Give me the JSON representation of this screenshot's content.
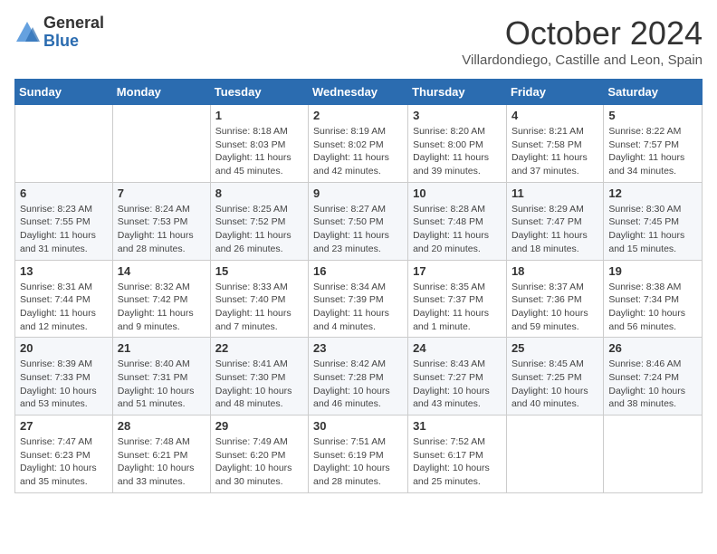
{
  "header": {
    "logo_general": "General",
    "logo_blue": "Blue",
    "month_title": "October 2024",
    "location": "Villardondiego, Castille and Leon, Spain"
  },
  "days_of_week": [
    "Sunday",
    "Monday",
    "Tuesday",
    "Wednesday",
    "Thursday",
    "Friday",
    "Saturday"
  ],
  "weeks": [
    [
      {
        "day": "",
        "text": ""
      },
      {
        "day": "",
        "text": ""
      },
      {
        "day": "1",
        "text": "Sunrise: 8:18 AM\nSunset: 8:03 PM\nDaylight: 11 hours and 45 minutes."
      },
      {
        "day": "2",
        "text": "Sunrise: 8:19 AM\nSunset: 8:02 PM\nDaylight: 11 hours and 42 minutes."
      },
      {
        "day": "3",
        "text": "Sunrise: 8:20 AM\nSunset: 8:00 PM\nDaylight: 11 hours and 39 minutes."
      },
      {
        "day": "4",
        "text": "Sunrise: 8:21 AM\nSunset: 7:58 PM\nDaylight: 11 hours and 37 minutes."
      },
      {
        "day": "5",
        "text": "Sunrise: 8:22 AM\nSunset: 7:57 PM\nDaylight: 11 hours and 34 minutes."
      }
    ],
    [
      {
        "day": "6",
        "text": "Sunrise: 8:23 AM\nSunset: 7:55 PM\nDaylight: 11 hours and 31 minutes."
      },
      {
        "day": "7",
        "text": "Sunrise: 8:24 AM\nSunset: 7:53 PM\nDaylight: 11 hours and 28 minutes."
      },
      {
        "day": "8",
        "text": "Sunrise: 8:25 AM\nSunset: 7:52 PM\nDaylight: 11 hours and 26 minutes."
      },
      {
        "day": "9",
        "text": "Sunrise: 8:27 AM\nSunset: 7:50 PM\nDaylight: 11 hours and 23 minutes."
      },
      {
        "day": "10",
        "text": "Sunrise: 8:28 AM\nSunset: 7:48 PM\nDaylight: 11 hours and 20 minutes."
      },
      {
        "day": "11",
        "text": "Sunrise: 8:29 AM\nSunset: 7:47 PM\nDaylight: 11 hours and 18 minutes."
      },
      {
        "day": "12",
        "text": "Sunrise: 8:30 AM\nSunset: 7:45 PM\nDaylight: 11 hours and 15 minutes."
      }
    ],
    [
      {
        "day": "13",
        "text": "Sunrise: 8:31 AM\nSunset: 7:44 PM\nDaylight: 11 hours and 12 minutes."
      },
      {
        "day": "14",
        "text": "Sunrise: 8:32 AM\nSunset: 7:42 PM\nDaylight: 11 hours and 9 minutes."
      },
      {
        "day": "15",
        "text": "Sunrise: 8:33 AM\nSunset: 7:40 PM\nDaylight: 11 hours and 7 minutes."
      },
      {
        "day": "16",
        "text": "Sunrise: 8:34 AM\nSunset: 7:39 PM\nDaylight: 11 hours and 4 minutes."
      },
      {
        "day": "17",
        "text": "Sunrise: 8:35 AM\nSunset: 7:37 PM\nDaylight: 11 hours and 1 minute."
      },
      {
        "day": "18",
        "text": "Sunrise: 8:37 AM\nSunset: 7:36 PM\nDaylight: 10 hours and 59 minutes."
      },
      {
        "day": "19",
        "text": "Sunrise: 8:38 AM\nSunset: 7:34 PM\nDaylight: 10 hours and 56 minutes."
      }
    ],
    [
      {
        "day": "20",
        "text": "Sunrise: 8:39 AM\nSunset: 7:33 PM\nDaylight: 10 hours and 53 minutes."
      },
      {
        "day": "21",
        "text": "Sunrise: 8:40 AM\nSunset: 7:31 PM\nDaylight: 10 hours and 51 minutes."
      },
      {
        "day": "22",
        "text": "Sunrise: 8:41 AM\nSunset: 7:30 PM\nDaylight: 10 hours and 48 minutes."
      },
      {
        "day": "23",
        "text": "Sunrise: 8:42 AM\nSunset: 7:28 PM\nDaylight: 10 hours and 46 minutes."
      },
      {
        "day": "24",
        "text": "Sunrise: 8:43 AM\nSunset: 7:27 PM\nDaylight: 10 hours and 43 minutes."
      },
      {
        "day": "25",
        "text": "Sunrise: 8:45 AM\nSunset: 7:25 PM\nDaylight: 10 hours and 40 minutes."
      },
      {
        "day": "26",
        "text": "Sunrise: 8:46 AM\nSunset: 7:24 PM\nDaylight: 10 hours and 38 minutes."
      }
    ],
    [
      {
        "day": "27",
        "text": "Sunrise: 7:47 AM\nSunset: 6:23 PM\nDaylight: 10 hours and 35 minutes."
      },
      {
        "day": "28",
        "text": "Sunrise: 7:48 AM\nSunset: 6:21 PM\nDaylight: 10 hours and 33 minutes."
      },
      {
        "day": "29",
        "text": "Sunrise: 7:49 AM\nSunset: 6:20 PM\nDaylight: 10 hours and 30 minutes."
      },
      {
        "day": "30",
        "text": "Sunrise: 7:51 AM\nSunset: 6:19 PM\nDaylight: 10 hours and 28 minutes."
      },
      {
        "day": "31",
        "text": "Sunrise: 7:52 AM\nSunset: 6:17 PM\nDaylight: 10 hours and 25 minutes."
      },
      {
        "day": "",
        "text": ""
      },
      {
        "day": "",
        "text": ""
      }
    ]
  ]
}
